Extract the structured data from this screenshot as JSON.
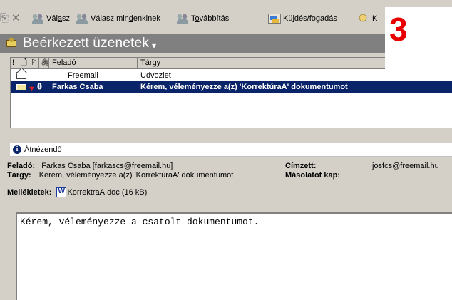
{
  "toolbar": {
    "items": [
      {
        "label_pre": "",
        "label_u": "",
        "label_post": "Válasz",
        "raw": "Válasz"
      },
      {
        "label": "Válasz mindenkinek"
      },
      {
        "label": "Továbbítás"
      },
      {
        "label": "Küldés/fogadás"
      },
      {
        "label": "K"
      }
    ],
    "reply": {
      "pre": "Vál",
      "u": "a",
      "post": "sz"
    },
    "reply_all": {
      "pre": "Válasz min",
      "u": "d",
      "post": "enkinek"
    },
    "forward": {
      "pre": "T",
      "u": "o",
      "post": "vábbítás"
    },
    "send_receive": {
      "pre": "Kü",
      "u": "l",
      "post": "dés/fogadás"
    },
    "find_partial": "K"
  },
  "overlay_number": "3",
  "folder": {
    "title": "Beérkezett üzenetek",
    "chevron": "▾"
  },
  "list": {
    "columns": {
      "importance": "!",
      "type": "🗋",
      "flag": "⚐",
      "attachment": "🖇",
      "from": "Feladó",
      "subject": "Tárgy"
    },
    "rows": [
      {
        "from": "Freemail",
        "subject": "Udvozlet",
        "selected": false
      },
      {
        "from": "Farkas Csaba",
        "subject": "Kérem, véleményezze a(z) 'KorrektúraA' dokumentumot",
        "selected": true
      }
    ]
  },
  "preview": {
    "infobar": "Átnézendő",
    "from_label": "Feladó:",
    "from_value": "Farkas Csaba [farkascs@freemail.hu]",
    "to_label": "Címzett:",
    "to_value": "josfcs@freemail.hu",
    "subject_label": "Tárgy:",
    "subject_value": "Kérem, véleményezze a(z) 'KorrektúraA' dokumentumot",
    "cc_label": "Másolatot kap:",
    "attachments_label": "Mellékletek:",
    "attachment_name": "KorrektraA.doc (16 kB)",
    "body": "Kérem, véleményezze a csatolt dokumentumot."
  }
}
